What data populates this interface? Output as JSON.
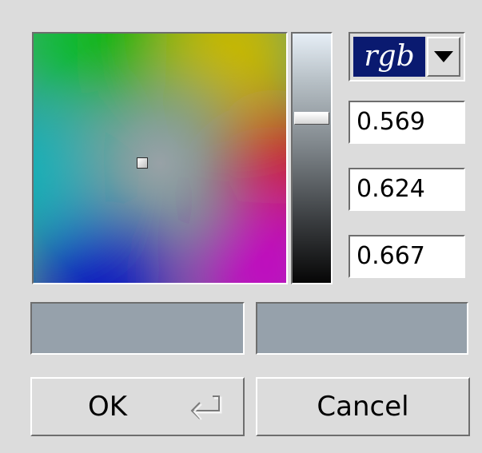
{
  "color_picker": {
    "mode": "rgb",
    "fields": {
      "r": "0.569",
      "g": "0.624",
      "b": "0.667"
    },
    "value_level": 0.67,
    "swatches": {
      "old_color": "#96a1ab",
      "new_color": "#96a1ab"
    }
  },
  "buttons": {
    "ok_label": "OK",
    "cancel_label": "Cancel"
  },
  "icons": {
    "enter": "enter-key-icon",
    "dropdown": "triangle-down-icon"
  }
}
